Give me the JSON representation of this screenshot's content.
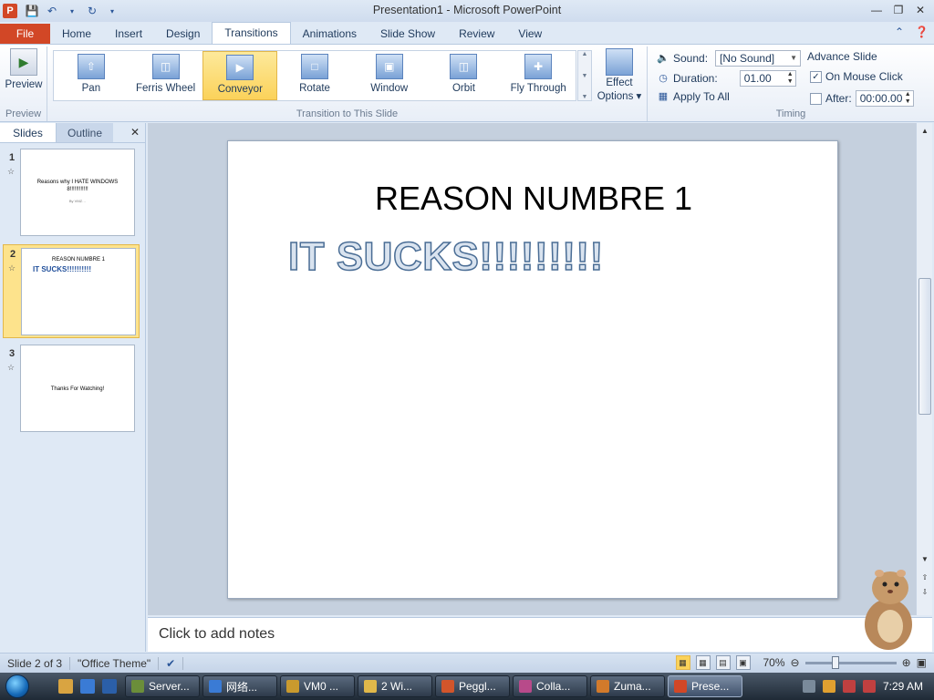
{
  "window": {
    "title": "Presentation1 - Microsoft PowerPoint",
    "app_letter": "P",
    "controls": [
      "—",
      "❐",
      "✕"
    ]
  },
  "ribbon_tabs": [
    "File",
    "Home",
    "Insert",
    "Design",
    "Transitions",
    "Animations",
    "Slide Show",
    "Review",
    "View"
  ],
  "active_tab": "Transitions",
  "ribbon": {
    "preview": {
      "label": "Preview",
      "group_label": "Preview"
    },
    "transitions": {
      "group_label": "Transition to This Slide",
      "items": [
        {
          "label": "Pan"
        },
        {
          "label": "Ferris Wheel"
        },
        {
          "label": "Conveyor"
        },
        {
          "label": "Rotate"
        },
        {
          "label": "Window"
        },
        {
          "label": "Orbit"
        },
        {
          "label": "Fly Through"
        }
      ],
      "selected": "Conveyor",
      "effect_options_line1": "Effect",
      "effect_options_line2": "Options ▾"
    },
    "timing": {
      "group_label": "Timing",
      "sound_label": "Sound:",
      "sound_value": "[No Sound]",
      "duration_label": "Duration:",
      "duration_value": "01.00",
      "apply_all_label": "Apply To All",
      "advance_label": "Advance Slide",
      "on_click_label": "On Mouse Click",
      "on_click_checked": true,
      "after_label": "After:",
      "after_checked": false,
      "after_value": "00:00.00"
    }
  },
  "left_pane": {
    "tabs": [
      "Slides",
      "Outline"
    ],
    "close": "✕",
    "thumbnails": [
      {
        "num": "1",
        "title": "Reasons why I HATE WINDOWS 8!!!!!!!!!!!!",
        "subtitle": "By VMZ…"
      },
      {
        "num": "2",
        "title": "REASON NUMBRE 1",
        "body": "IT SUCKS!!!!!!!!!!"
      },
      {
        "num": "3",
        "title": "Thanks For Watching!"
      }
    ],
    "selected_index": 1
  },
  "slide": {
    "title": "REASON NUMBRE 1",
    "body": "IT SUCKS!!!!!!!!!"
  },
  "notes": {
    "placeholder": "Click to add notes"
  },
  "status_bar": {
    "slide_info": "Slide 2 of 3",
    "theme": "\"Office Theme\"",
    "zoom": "70%",
    "zoom_level_percent": 70
  },
  "taskbar": {
    "tasks": [
      {
        "label": "Server...",
        "color": "#6b8e3a"
      },
      {
        "label": "网络...",
        "color": "#3a7bd5"
      },
      {
        "label": "VM0 ...",
        "color": "#c99a2e"
      },
      {
        "label": "2 Wi...",
        "color": "#e0b84a"
      },
      {
        "label": "Peggl...",
        "color": "#d2552b"
      },
      {
        "label": "Colla...",
        "color": "#b84a8a"
      },
      {
        "label": "Zuma...",
        "color": "#d27a2b"
      },
      {
        "label": "Prese...",
        "color": "#d24726"
      }
    ],
    "active_task": "Prese...",
    "clock": "7:29 AM"
  },
  "colors": {
    "file_tab": "#d24726",
    "selected_gallery": "#fbd25a",
    "ribbon_bg": "#dfe9f5"
  }
}
